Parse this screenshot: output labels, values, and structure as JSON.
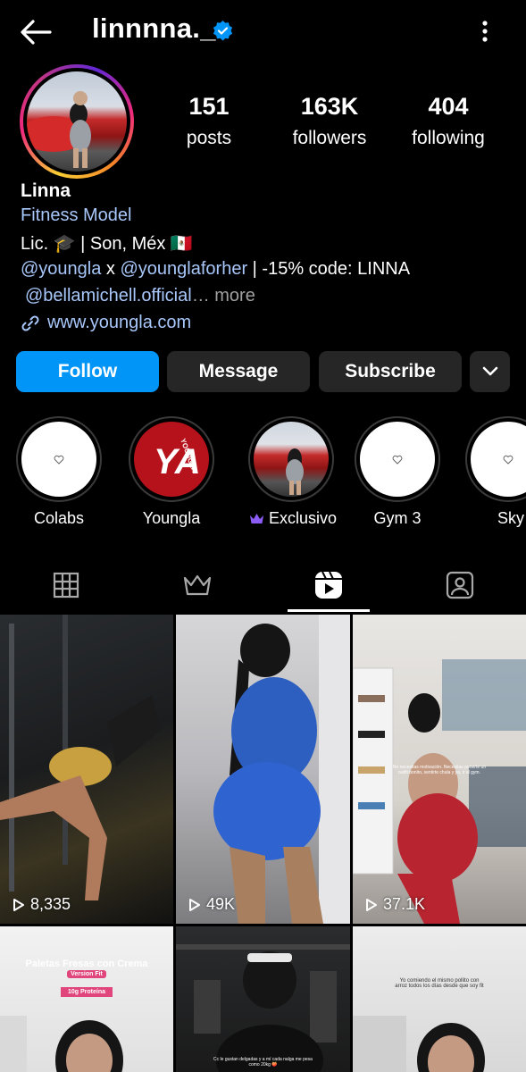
{
  "header": {
    "username": "linnnna._",
    "back_icon": "back-arrow-icon",
    "verified_icon": "verified-badge-icon",
    "menu_icon": "kebab-menu-icon",
    "verified_color": "#0095f6"
  },
  "stats": {
    "posts_count": "151",
    "posts_label": "posts",
    "followers_count": "163K",
    "followers_label": "followers",
    "following_count": "404",
    "following_label": "following"
  },
  "bio": {
    "name": "Linna",
    "category": "Fitness Model",
    "line1_text": "Lic. 🎓 | Son, Méx 🇲🇽",
    "line2_mention1": "@youngla",
    "line2_x": " x ",
    "line2_mention2": "@younglaforher",
    "line2_rest": " | -15% code: LINNA",
    "line3_mention": "@bellamichell.official",
    "line3_more": "… more",
    "link": "www.youngla.com",
    "link_icon": "link-icon"
  },
  "actions": {
    "follow_label": "Follow",
    "message_label": "Message",
    "subscribe_label": "Subscribe",
    "dropdown_icon": "chevron-down-icon",
    "follow_color": "#0095f6"
  },
  "highlights": [
    {
      "label": "Colabs"
    },
    {
      "label": "Youngla",
      "logo_text": "YOUNGLA",
      "logo_mark": "YA"
    },
    {
      "label": "Exclusivo",
      "icon": "crown-icon"
    },
    {
      "label": "Gym 3"
    },
    {
      "label": "Sky"
    }
  ],
  "tabs": [
    {
      "name": "posts",
      "icon": "grid-icon"
    },
    {
      "name": "subscriptions",
      "icon": "crown-icon"
    },
    {
      "name": "reels",
      "icon": "reels-icon",
      "active": true
    },
    {
      "name": "tagged",
      "icon": "tagged-person-icon"
    }
  ],
  "reels": [
    {
      "views": "8,335"
    },
    {
      "views": "49K"
    },
    {
      "views": "37.1K",
      "caption": "No necesitas motivación. Necesitas ponerte un outfit bonito, sentirte chula y ya, ir al gym."
    },
    {
      "caption": "Paletas Fresas con Crema",
      "caption_badge": "Version Fit",
      "caption_sub": "10g Proteína"
    },
    {
      "caption": "Cc le gustan delgadas y a mí cada nalga me pesa como 20kg 🍑"
    },
    {
      "caption": "Yo comiendo el mismo pollito con arroz todos los días desde que soy fit"
    }
  ]
}
